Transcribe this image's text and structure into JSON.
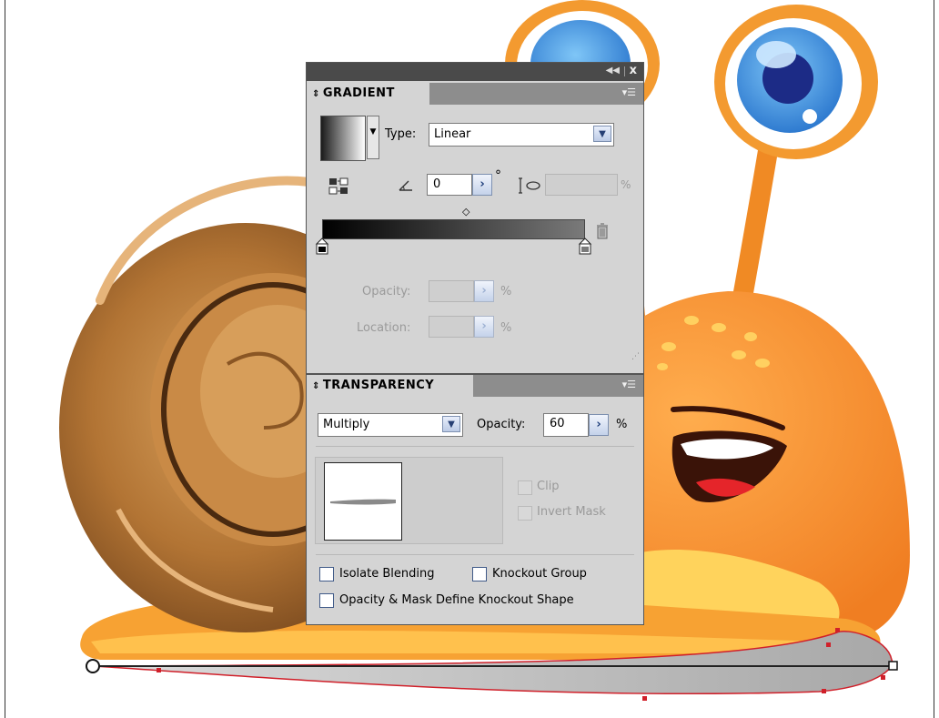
{
  "colors": {
    "panel_bg": "#d4d4d4",
    "titlebar": "#4a4a4a",
    "tab_strip": "#8d8d8d",
    "snail_body": "#f5922f",
    "snail_shell": "#a86a2e",
    "eye_blue": "#3d8ed9",
    "path_red": "#d0202a"
  },
  "titlebar": {
    "collapse_icon": "double-chevron-left-icon",
    "close_label": "x"
  },
  "gradient": {
    "tab_label": "GRADIENT",
    "type_label": "Type:",
    "type_value": "Linear",
    "angle_value": "0",
    "degree_symbol": "°",
    "aspect_value": "",
    "percent": "%",
    "opacity_label": "Opacity:",
    "opacity_value": "",
    "location_label": "Location:",
    "location_value": "",
    "stops": [
      {
        "color": "#000000",
        "location_pct": 0
      },
      {
        "color": "#7a7a7a",
        "location_pct": 100
      }
    ],
    "midpoint_pct": 50
  },
  "transparency": {
    "tab_label": "TRANSPARENCY",
    "blend_mode": "Multiply",
    "opacity_label": "Opacity:",
    "opacity_value": "60",
    "percent": "%",
    "clip_label": "Clip",
    "invert_mask_label": "Invert Mask",
    "isolate_blending_label": "Isolate Blending",
    "knockout_group_label": "Knockout Group",
    "opacity_mask_label": "Opacity & Mask Define Knockout Shape"
  }
}
